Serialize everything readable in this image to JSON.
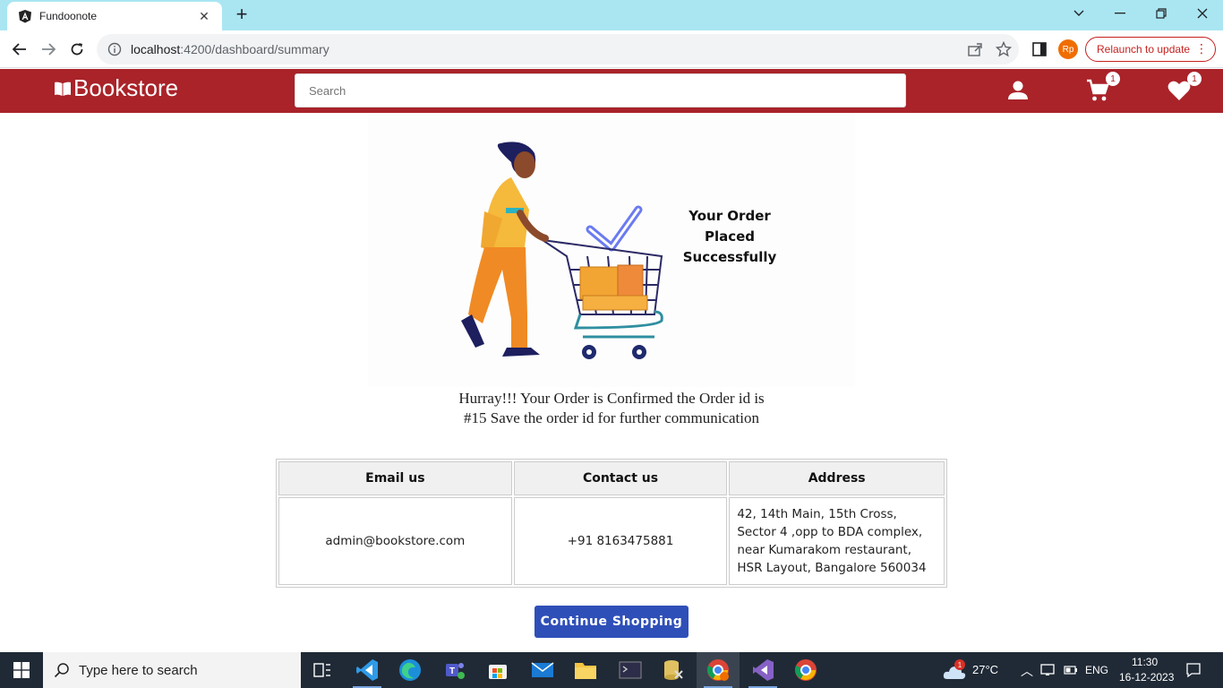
{
  "browser": {
    "tab_title": "Fundoonote",
    "url_host": "localhost",
    "url_path": ":4200/dashboard/summary",
    "relaunch_label": "Relaunch to update",
    "profile_initials": "Rp"
  },
  "header": {
    "brand": "Bookstore",
    "search_placeholder": "Search",
    "cart_count": "1",
    "wishlist_count": "1"
  },
  "illustration": {
    "line1": "Your Order",
    "line2": "Placed Successfully"
  },
  "confirmation": {
    "message": "Hurray!!! Your Order is Confirmed the Order id is #15 Save the order id for further communication"
  },
  "contact_table": {
    "headers": [
      "Email us",
      "Contact us",
      "Address"
    ],
    "email": "admin@bookstore.com",
    "phone": "+91 8163475881",
    "address": "42, 14th Main, 15th Cross, Sector 4 ,opp to BDA complex, near Kumarakom restaurant, HSR Layout, Bangalore 560034"
  },
  "continue_label": "Continue Shopping",
  "taskbar": {
    "search_placeholder": "Type here to search",
    "weather": "27°C",
    "weather_badge": "1",
    "language": "ENG",
    "time": "11:30",
    "date": "16-12-2023"
  },
  "colors": {
    "appbar": "#a92329",
    "button": "#2f4fb8",
    "tabstrip": "#a9e6f2"
  }
}
